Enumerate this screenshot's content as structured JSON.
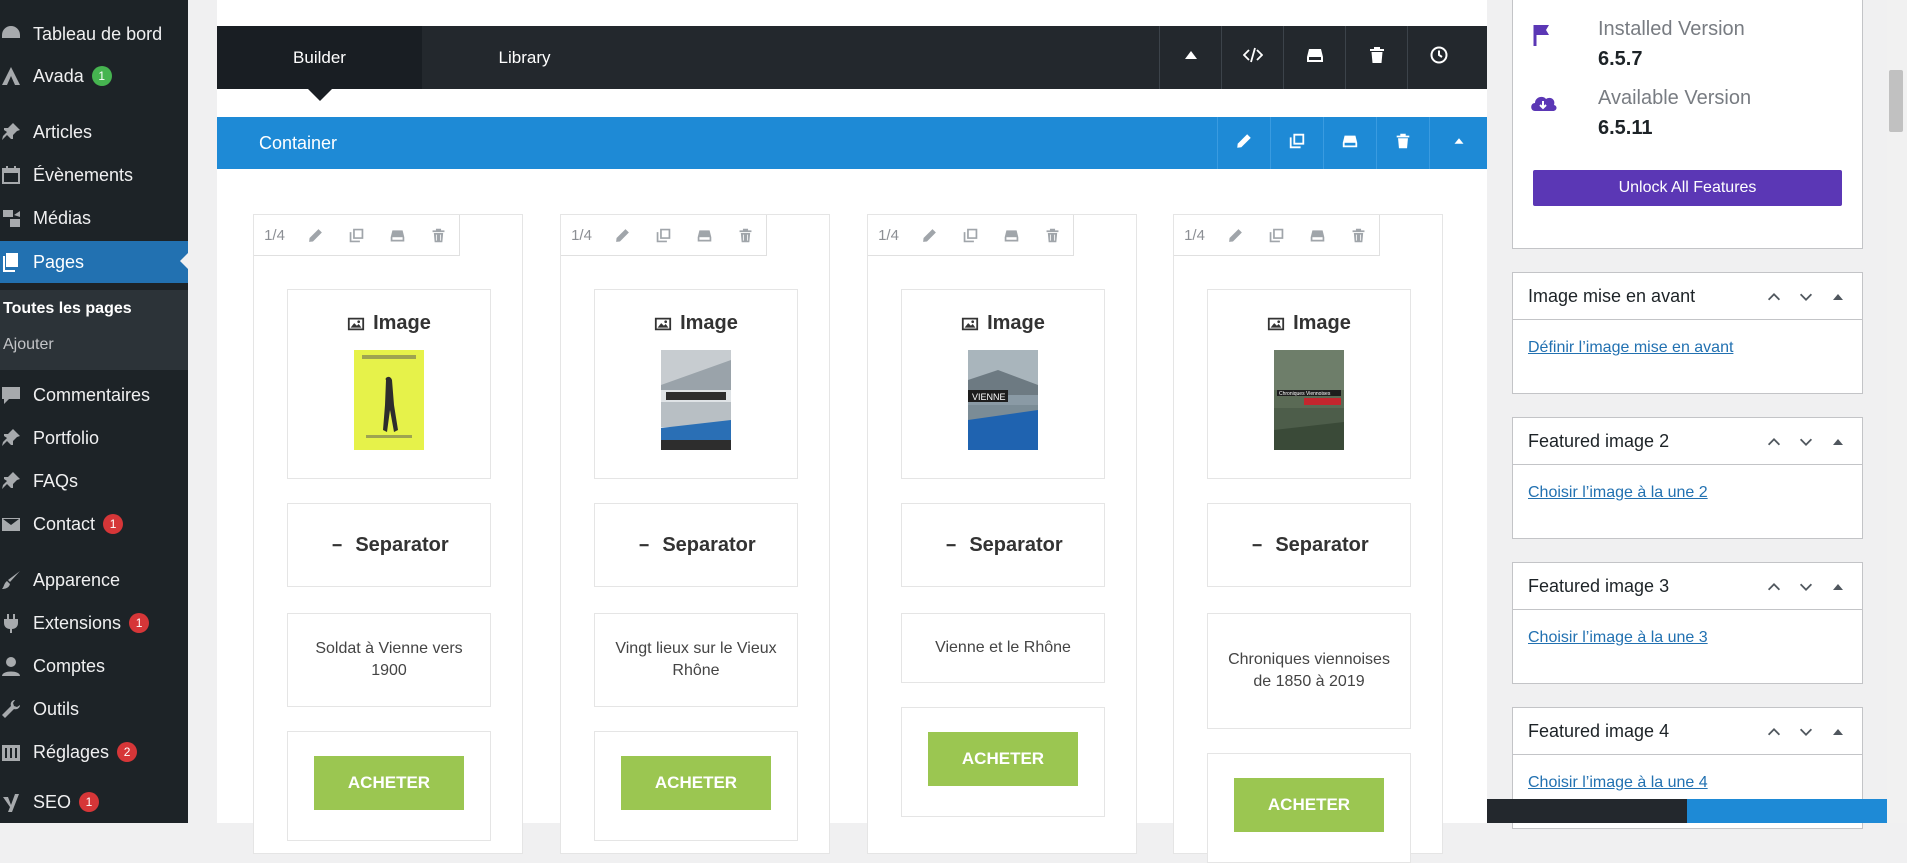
{
  "sidebar": {
    "items": [
      {
        "label": "Tableau de bord",
        "icon": "dashboard-icon"
      },
      {
        "label": "Avada",
        "icon": "avada-icon",
        "badge": "1",
        "badge_color": "#46b450"
      },
      {
        "label": "Articles",
        "icon": "pushpin-icon"
      },
      {
        "label": "Évènements",
        "icon": "calendar-icon"
      },
      {
        "label": "Médias",
        "icon": "media-icon"
      },
      {
        "label": "Pages",
        "icon": "pages-icon",
        "active": true
      },
      {
        "label": "Commentaires",
        "icon": "comment-icon"
      },
      {
        "label": "Portfolio",
        "icon": "pushpin-icon"
      },
      {
        "label": "FAQs",
        "icon": "pushpin-icon"
      },
      {
        "label": "Contact",
        "icon": "mail-icon",
        "badge": "1",
        "badge_color": "#d63638"
      },
      {
        "label": "Apparence",
        "icon": "brush-icon"
      },
      {
        "label": "Extensions",
        "icon": "plugin-icon",
        "badge": "1",
        "badge_color": "#d63638"
      },
      {
        "label": "Comptes",
        "icon": "user-icon"
      },
      {
        "label": "Outils",
        "icon": "wrench-icon"
      },
      {
        "label": "Réglages",
        "icon": "settings-icon",
        "badge": "2",
        "badge_color": "#d63638"
      },
      {
        "label": "SEO",
        "icon": "yoast-icon",
        "badge": "1",
        "badge_color": "#d63638"
      }
    ],
    "submenu": {
      "current": "Toutes les pages",
      "add": "Ajouter"
    }
  },
  "builder": {
    "tab_builder": "Builder",
    "tab_library": "Library",
    "actions": [
      "collapse-icon",
      "code-icon",
      "save-icon",
      "trash-icon",
      "history-icon"
    ]
  },
  "container": {
    "title": "Container",
    "actions": [
      "edit-icon",
      "clone-icon",
      "save-icon",
      "trash-icon",
      "collapse-icon"
    ]
  },
  "columns": [
    {
      "size": "1/4",
      "image_label": "Image",
      "separator_label": "Separator",
      "text": "Soldat à Vienne vers 1900",
      "button": "ACHETER"
    },
    {
      "size": "1/4",
      "image_label": "Image",
      "separator_label": "Separator",
      "text": "Vingt lieux sur le Vieux Rhône",
      "button": "ACHETER"
    },
    {
      "size": "1/4",
      "image_label": "Image",
      "separator_label": "Separator",
      "text": "Vienne et le Rhône",
      "button": "ACHETER"
    },
    {
      "size": "1/4",
      "image_label": "Image",
      "separator_label": "Separator",
      "text": "Chroniques viennoises de 1850 à 2019",
      "button": "ACHETER"
    }
  ],
  "book_covers": [
    {
      "caption": "",
      "colors": [
        "#e6f24a",
        "#2d2d2d"
      ]
    },
    {
      "caption": "",
      "colors": [
        "#dfe3e6",
        "#2a6fb5"
      ]
    },
    {
      "caption": "VIENNE",
      "colors": [
        "#8a9aa5",
        "#1f63b0"
      ]
    },
    {
      "caption": "Chroniques Viennoises",
      "colors": [
        "#5a6a55",
        "#c4262e"
      ]
    }
  ],
  "right_panel": {
    "installed_label": "Installed Version",
    "installed_value": "6.5.7",
    "available_label": "Available Version",
    "available_value": "6.5.11",
    "unlock_label": "Unlock All Features",
    "accent": "#5b37b5",
    "meta_boxes": [
      {
        "title": "Image mise en avant",
        "link": "Définir l’image mise en avant"
      },
      {
        "title": "Featured image 2",
        "link": "Choisir l’image à la une 2"
      },
      {
        "title": "Featured image 3",
        "link": "Choisir l’image à la une 3"
      },
      {
        "title": "Featured image 4",
        "link": "Choisir l’image à la une 4"
      }
    ]
  },
  "colors": {
    "sidebar_bg": "#1d2327",
    "active_blue": "#2271b1",
    "container_blue": "#1e8ad6",
    "buy_green": "#9bc651"
  }
}
